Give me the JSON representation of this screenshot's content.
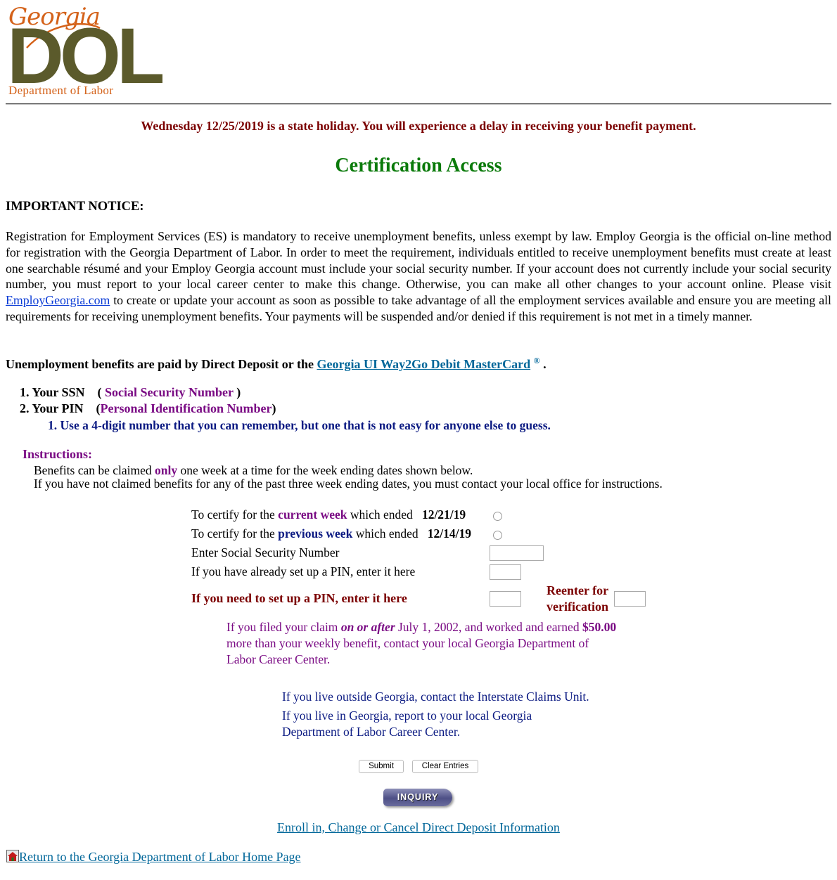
{
  "logo": {
    "georgia": "Georgia",
    "dol": "DOL",
    "department": "Department of Labor"
  },
  "holiday_notice": "Wednesday 12/25/2019 is a state holiday. You will experience a delay in receiving your benefit payment.",
  "page_title": "Certification Access",
  "notice": {
    "heading": "IMPORTANT NOTICE:",
    "body_before_link": "Registration for Employment Services (ES) is mandatory to receive unemployment benefits, unless exempt by law. Employ Georgia is the official on-line method for registration with the Georgia Department of Labor. In order to meet the requirement, individuals entitled to receive unemployment benefits must create at least one searchable résumé and your Employ Georgia account must include your social security number. If your account does not currently include your social security number, you must report to your local career center to make this change. Otherwise, you can make all other changes to your account online. Please visit ",
    "link_text": "EmployGeorgia.com",
    "body_after_link": " to create or update your account as soon as possible to take advantage of all the employment services available and ensure you are meeting all requirements for receiving unemployment benefits. Your payments will be suspended and/or denied if this requirement is not met in a timely manner."
  },
  "benefits": {
    "prefix": "Unemployment benefits are paid by Direct Deposit or the ",
    "link_text": "Georgia UI Way2Go Debit MasterCard",
    "registered": "®",
    "suffix": " ."
  },
  "requirements": {
    "ssn_label": "1. Your SSN",
    "ssn_open": "(",
    "ssn_desc": " Social Security Number ",
    "ssn_close": ")",
    "pin_label": "2. Your PIN",
    "pin_open": "(",
    "pin_desc": "Personal Identification Number",
    "pin_close": ")",
    "pin_hint": "1. Use a 4-digit number that you can remember, but one that is not easy for anyone else to guess."
  },
  "instructions": {
    "heading": "Instructions:",
    "line1_before": "Benefits can be claimed ",
    "line1_emph": "only",
    "line1_after": " one week at a time for the week ending dates shown below.",
    "line2": "If you have not claimed benefits for any of the past three week ending dates, you must contact your local office for instructions."
  },
  "form": {
    "current_prefix": "To certify for the ",
    "current_emph": "current week",
    "current_mid": " which ended ",
    "current_date": "12/21/19",
    "previous_prefix": "To certify for the ",
    "previous_emph": "previous week",
    "previous_mid": " which ended ",
    "previous_date": "12/14/19",
    "ssn_label": "Enter Social Security Number",
    "ssn_value": "",
    "pin_label": "If you have already set up a PIN, enter it here",
    "pin_value": "",
    "newpin_label": "If you need to set up a PIN, enter it here",
    "newpin_value": "",
    "reenter_line1": "Reenter for",
    "reenter_line2": "verification",
    "reenter_value": ""
  },
  "claim_note": {
    "before": "If you filed your claim ",
    "emph": "on or after",
    "mid": " July 1, 2002, and worked and earned ",
    "amount": "$50.00",
    "after": " more than your weekly benefit, contact your local Georgia Department of Labor Career Center."
  },
  "outside_note": "If you live outside Georgia, contact the Interstate Claims Unit.",
  "inside_note": "If you live in Georgia, report to your local Georgia Department of Labor Career Center.",
  "buttons": {
    "submit": "Submit",
    "clear": "Clear Entries",
    "inquiry": "INQUIRY"
  },
  "links": {
    "direct_deposit": "Enroll in, Change or Cancel Direct Deposit Information",
    "home": "Return to the Georgia Department of Labor Home Page"
  },
  "colors": {
    "holiday": "#7b0000",
    "title": "#0a7a0a",
    "purple": "#7a0b84",
    "navy": "#0b1a82",
    "link": "#006699",
    "logo_olive": "#5b5a2b",
    "logo_orange": "#d4621a"
  },
  "icons": {
    "home": "home-icon"
  }
}
